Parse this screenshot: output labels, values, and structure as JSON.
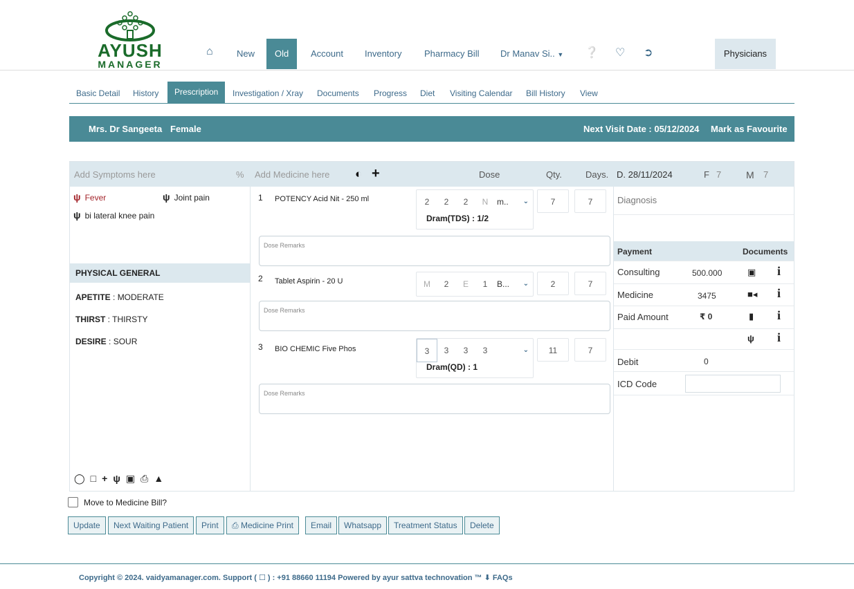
{
  "logo": {
    "line1": "AYUSH",
    "line2": "MANAGER"
  },
  "topnav": {
    "items": [
      "New",
      "Old",
      "Account",
      "Inventory",
      "Pharmacy Bill",
      "Dr Manav Si.."
    ],
    "physicians": "Physicians"
  },
  "tabs": [
    "Basic Detail",
    "History",
    "Prescription",
    "Investigation / Xray",
    "Documents",
    "Progress",
    "Diet",
    "Visiting Calendar",
    "Bill History",
    "View"
  ],
  "patient": {
    "name": "Mrs. Dr Sangeeta",
    "gender": "Female",
    "next_visit": "Next Visit Date : 05/12/2024",
    "favourite": "Mark as Favourite"
  },
  "header": {
    "symptoms_placeholder": "Add Symptoms here",
    "percent": "%",
    "medicine_placeholder": "Add Medicine here",
    "dose": "Dose",
    "qty": "Qty.",
    "days": "Days.",
    "date": "D. 28/11/2024",
    "f_label": "F",
    "f_val": "7",
    "m_label": "M",
    "m_val": "7"
  },
  "symptoms": [
    "Fever",
    "Joint pain",
    "bi lateral knee pain"
  ],
  "physical_general": {
    "title": "PHYSICAL GENERAL",
    "items": [
      {
        "key": "APETITE",
        "value": "MODERATE"
      },
      {
        "key": "THIRST",
        "value": "THIRSTY"
      },
      {
        "key": "DESIRE",
        "value": "SOUR"
      }
    ]
  },
  "medicines": [
    {
      "num": "1",
      "name": "POTENCY Acid Nit - 250 ml",
      "dose": [
        "2",
        "2",
        "2",
        "N"
      ],
      "unit": "m..",
      "sub": "Dram(TDS) : 1/2",
      "qty": "7",
      "days": "7",
      "remarks": "Dose Remarks"
    },
    {
      "num": "2",
      "name": "Tablet Aspirin - 20 U",
      "dose": [
        "M",
        "2",
        "E",
        "1"
      ],
      "unit": "B...",
      "sub": "",
      "qty": "2",
      "days": "7",
      "remarks": "Dose Remarks"
    },
    {
      "num": "3",
      "name": "BIO CHEMIC Five Phos",
      "dose": [
        "3",
        "3",
        "3",
        "3"
      ],
      "unit": "",
      "sub": "Dram(QD) : 1",
      "qty": "11",
      "days": "7",
      "remarks": "Dose Remarks"
    }
  ],
  "right": {
    "diagnosis": "Diagnosis",
    "payment": "Payment",
    "documents": "Documents",
    "consulting": "Consulting",
    "consulting_val": "500.000",
    "medicine": "Medicine",
    "medicine_val": "3475",
    "paid": "Paid Amount",
    "paid_val": "₹ 0",
    "debit": "Debit",
    "debit_val": "0",
    "icd": "ICD Code"
  },
  "move_to_bill": "Move to Medicine Bill?",
  "buttons": [
    "Update",
    "Next Waiting Patient",
    "Print",
    "Medicine Print",
    "Email",
    "Whatsapp",
    "Treatment Status",
    "Delete"
  ],
  "footer": "Copyright © 2024. vaidyamanager.com.   Support ( ☐ ) : +91 88660 11194   Powered by ayur sattva technovation ™      ⬇  FAQs",
  "colors": {
    "accent": "#4a8a96",
    "light": "#dce8ee",
    "link": "#3d6a8a",
    "symptom": "#a3242a"
  }
}
